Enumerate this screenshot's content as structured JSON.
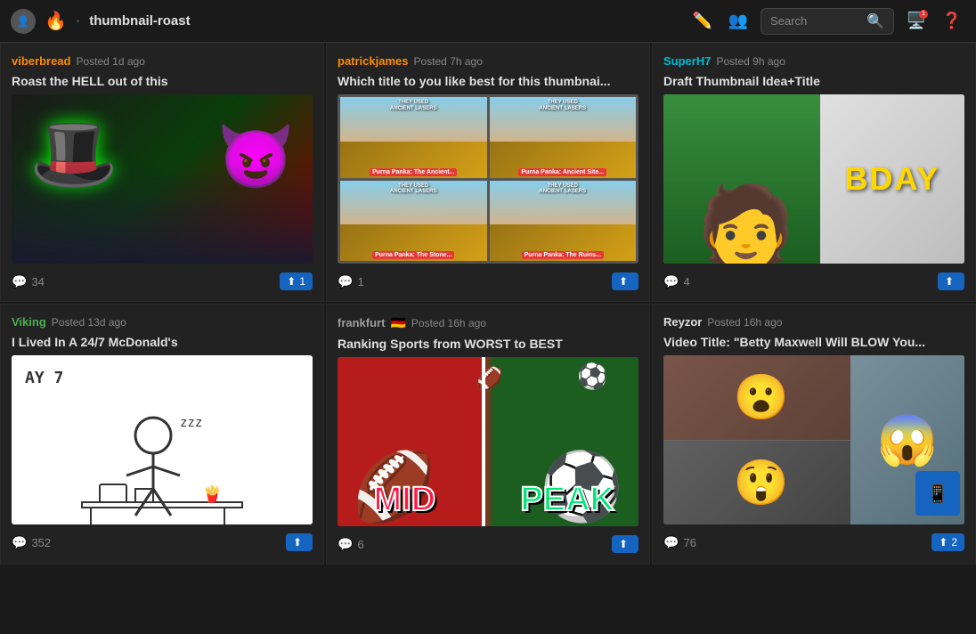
{
  "header": {
    "logo_icon": "👤",
    "fire_icon": "🔥",
    "dot": "·",
    "title": "thumbnail-roast",
    "search_placeholder": "Search",
    "notification_count": "1"
  },
  "icons": {
    "pencil": "✏",
    "people": "👥",
    "search": "🔍",
    "monitor": "🖥",
    "help": "?"
  },
  "cards": [
    {
      "username": "viberbread",
      "username_color": "orange",
      "time": "Posted 1d ago",
      "title": "Roast the HELL out of this",
      "comment_count": "34",
      "upvote_count": "1",
      "flag": ""
    },
    {
      "username": "patrickjames",
      "username_color": "orange",
      "time": "Posted 7h ago",
      "title": "Which title to you like best for this thumbnai...",
      "comment_count": "1",
      "upvote_count": "",
      "flag": ""
    },
    {
      "username": "SuperH7",
      "username_color": "teal",
      "time": "Posted 9h ago",
      "title": "Draft Thumbnail Idea+Title",
      "comment_count": "4",
      "upvote_count": "",
      "flag": ""
    },
    {
      "username": "Viking",
      "username_color": "green",
      "time": "Posted 13d ago",
      "title": "I Lived In A 24/7 McDonald's",
      "comment_count": "352",
      "upvote_count": "",
      "flag": ""
    },
    {
      "username": "frankfurt",
      "username_color": "grey",
      "time": "Posted 16h ago",
      "title": "Ranking Sports from WORST to BEST",
      "comment_count": "6",
      "upvote_count": "",
      "flag": "🇩🇪"
    },
    {
      "username": "Reyzor",
      "username_color": "white",
      "time": "Posted 16h ago",
      "title": "Video Title: \"Betty Maxwell Will BLOW You...",
      "comment_count": "76",
      "upvote_count": "2",
      "flag": ""
    }
  ]
}
